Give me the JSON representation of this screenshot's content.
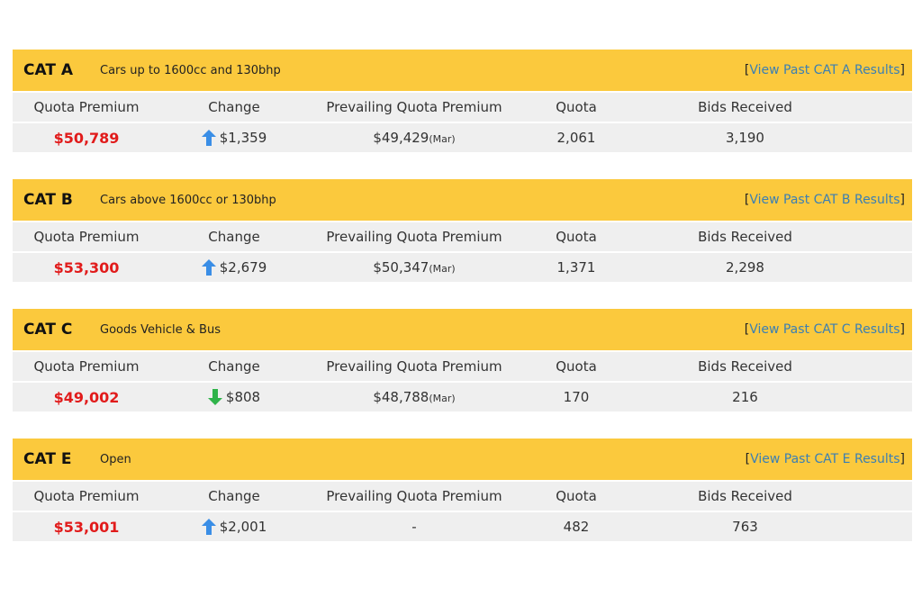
{
  "columns": {
    "quota_premium": "Quota Premium",
    "change": "Change",
    "prevailing": "Prevailing Quota Premium",
    "quota": "Quota",
    "bids": "Bids Received"
  },
  "categories": [
    {
      "name": "CAT A",
      "description": "Cars up to 1600cc and 130bhp",
      "link_text": "View Past CAT A Results",
      "quota_premium": "$50,789",
      "change_direction": "up",
      "change": "$1,359",
      "prevailing": "$49,429",
      "prevailing_month": "(Mar)",
      "quota": "2,061",
      "bids": "3,190"
    },
    {
      "name": "CAT B",
      "description": "Cars above 1600cc or 130bhp",
      "link_text": "View Past CAT B Results",
      "quota_premium": "$53,300",
      "change_direction": "up",
      "change": "$2,679",
      "prevailing": "$50,347",
      "prevailing_month": "(Mar)",
      "quota": "1,371",
      "bids": "2,298"
    },
    {
      "name": "CAT C",
      "description": "Goods Vehicle & Bus",
      "link_text": "View Past CAT C Results",
      "quota_premium": "$49,002",
      "change_direction": "down",
      "change": "$808",
      "prevailing": "$48,788",
      "prevailing_month": "(Mar)",
      "quota": "170",
      "bids": "216"
    },
    {
      "name": "CAT E",
      "description": "Open",
      "link_text": "View Past CAT E Results",
      "quota_premium": "$53,001",
      "change_direction": "up",
      "change": "$2,001",
      "prevailing": "-",
      "prevailing_month": "",
      "quota": "482",
      "bids": "763"
    }
  ],
  "colors": {
    "header_bg": "#fbc93d",
    "row_bg": "#efefef",
    "premium": "#e11b1b",
    "link": "#3b7fb3",
    "arrow_up": "#3a8ee6",
    "arrow_down": "#2fb34a"
  }
}
